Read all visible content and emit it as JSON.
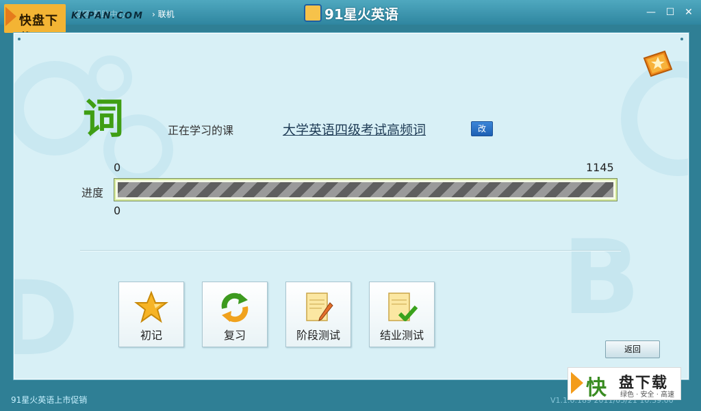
{
  "titlebar": {
    "app_title": "91星火英语",
    "menu_faded": "设置   帮助中心",
    "menu_online": "› 联机",
    "minimize_glyph": "—",
    "maximize_glyph": "☐",
    "close_glyph": "✕"
  },
  "watermark_top": {
    "logo_text": "快盘下载",
    "url": "KKPAN.COM"
  },
  "main": {
    "section_char": "词",
    "current_label": "正在学习的课",
    "course_name": "大学英语四级考试高频词",
    "change_button": "改",
    "progress": {
      "label": "进度",
      "start": "0",
      "end": "1145",
      "current": "0",
      "fraction": 0
    },
    "tiles": [
      {
        "label": "初记",
        "icon": "star-icon"
      },
      {
        "label": "复习",
        "icon": "refresh-icon"
      },
      {
        "label": "阶段测试",
        "icon": "notepad-pencil-icon"
      },
      {
        "label": "结业测试",
        "icon": "notepad-check-icon"
      }
    ],
    "back_button": "返回",
    "corner_icon": "book-star-icon"
  },
  "statusbar": {
    "promo": "91星火英语上市促销",
    "version": "V1.1.0.189  2011/05/21 10:39:00"
  },
  "watermark_bottom": {
    "kuai": "快",
    "main": "盘下载",
    "sub": "绿色 · 安全 · 高速"
  },
  "colors": {
    "frame": "#2f7f95",
    "panel": "#d8f0f6",
    "accent_green": "#3f9e14",
    "button_blue": "#1d5fb3"
  }
}
